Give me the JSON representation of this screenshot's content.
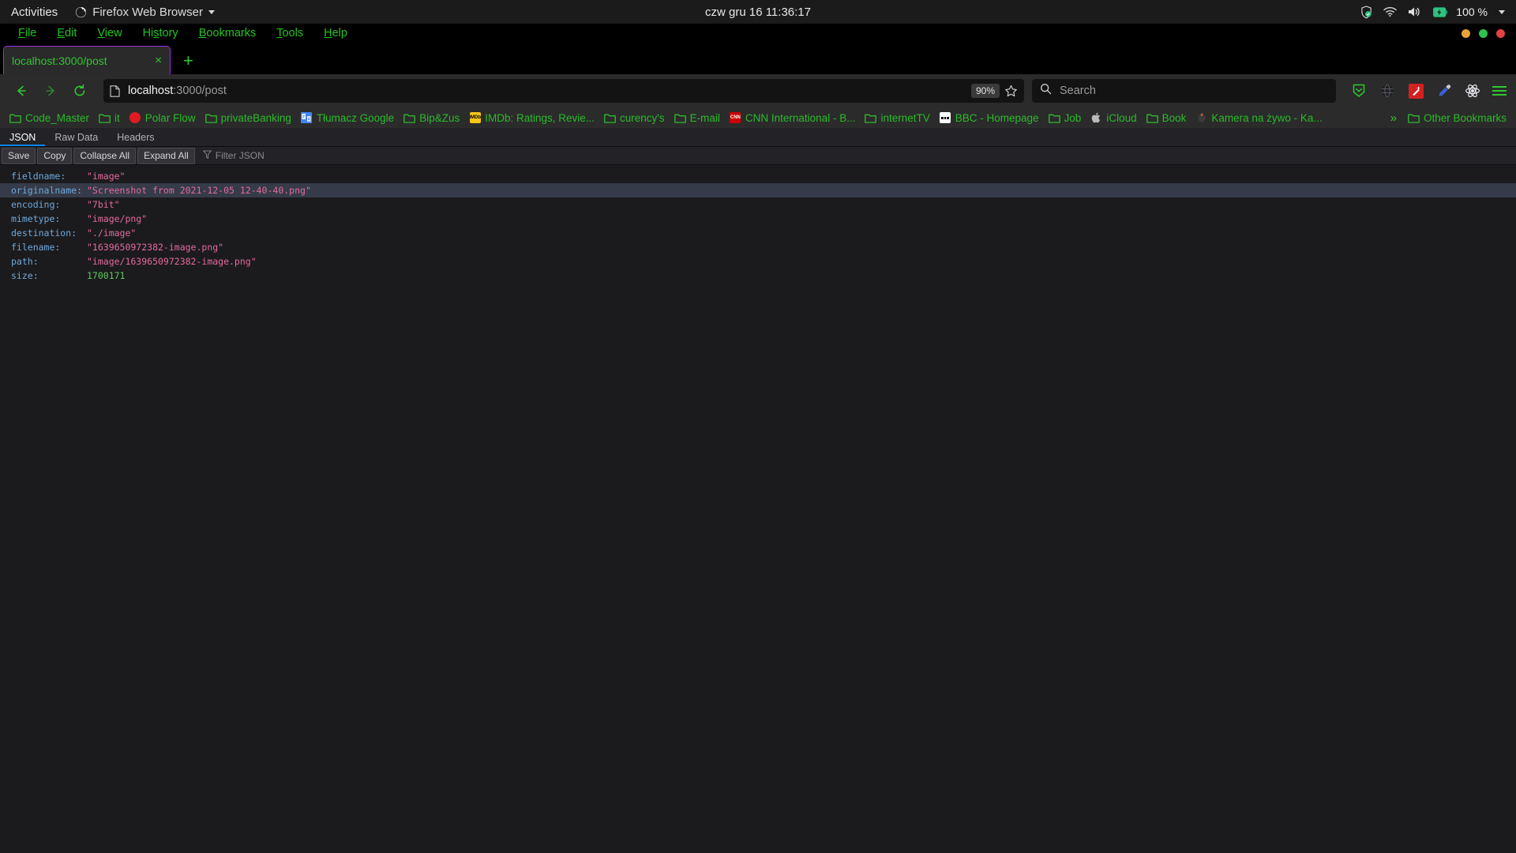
{
  "desktop": {
    "activities": "Activities",
    "app_name": "Firefox Web Browser",
    "clock": "czw gru 16  11:36:17",
    "battery_percent": "100 %"
  },
  "menubar": {
    "items": [
      {
        "label": "File",
        "accel": "F"
      },
      {
        "label": "Edit",
        "accel": "E"
      },
      {
        "label": "View",
        "accel": "V"
      },
      {
        "label": "History",
        "accel": "s"
      },
      {
        "label": "Bookmarks",
        "accel": "B"
      },
      {
        "label": "Tools",
        "accel": "T"
      },
      {
        "label": "Help",
        "accel": "H"
      }
    ]
  },
  "tabs": {
    "items": [
      {
        "title": "localhost:3000/post"
      }
    ],
    "new_tab_label": "+",
    "close_label": "×"
  },
  "navbar": {
    "url_host": "localhost",
    "url_path": ":3000/post",
    "zoom_level": "90%",
    "search_placeholder": "Search"
  },
  "bookmarks": {
    "items": [
      {
        "label": "Code_Master",
        "icon": "folder-icon"
      },
      {
        "label": "it",
        "icon": "folder-icon"
      },
      {
        "label": "Polar Flow",
        "icon": "polar-flow-icon"
      },
      {
        "label": "privateBanking",
        "icon": "folder-icon"
      },
      {
        "label": "Tłumacz Google",
        "icon": "google-translate-icon"
      },
      {
        "label": "Bip&Zus",
        "icon": "folder-icon"
      },
      {
        "label": "IMDb: Ratings, Revie...",
        "icon": "imdb-icon"
      },
      {
        "label": "curency's",
        "icon": "folder-icon"
      },
      {
        "label": "E-mail",
        "icon": "folder-icon"
      },
      {
        "label": "CNN International - B...",
        "icon": "cnn-icon"
      },
      {
        "label": "internetTV",
        "icon": "folder-icon"
      },
      {
        "label": "BBC - Homepage",
        "icon": "bbc-icon"
      },
      {
        "label": "Job",
        "icon": "folder-icon"
      },
      {
        "label": "iCloud",
        "icon": "apple-icon"
      },
      {
        "label": "Book",
        "icon": "folder-icon"
      },
      {
        "label": "Kamera na żywo - Ka...",
        "icon": "camera-icon"
      }
    ],
    "overflow_label": "»",
    "other_bookmarks": "Other Bookmarks"
  },
  "json_viewer": {
    "tabs": [
      {
        "label": "JSON",
        "active": true
      },
      {
        "label": "Raw Data",
        "active": false
      },
      {
        "label": "Headers",
        "active": false
      }
    ],
    "buttons": [
      "Save",
      "Copy",
      "Collapse All",
      "Expand All"
    ],
    "filter_placeholder": "Filter JSON",
    "rows": [
      {
        "key": "fieldname:",
        "value": "\"image\"",
        "type": "string",
        "highlight": false
      },
      {
        "key": "originalname:",
        "value": "\"Screenshot from 2021-12-05 12-40-40.png\"",
        "type": "string",
        "highlight": true
      },
      {
        "key": "encoding:",
        "value": "\"7bit\"",
        "type": "string",
        "highlight": false
      },
      {
        "key": "mimetype:",
        "value": "\"image/png\"",
        "type": "string",
        "highlight": false
      },
      {
        "key": "destination:",
        "value": "\"./image\"",
        "type": "string",
        "highlight": false
      },
      {
        "key": "filename:",
        "value": "\"1639650972382-image.png\"",
        "type": "string",
        "highlight": false
      },
      {
        "key": "path:",
        "value": "\"image/1639650972382-image.png\"",
        "type": "string",
        "highlight": false
      },
      {
        "key": "size:",
        "value": "1700171",
        "type": "number",
        "highlight": false
      }
    ]
  }
}
